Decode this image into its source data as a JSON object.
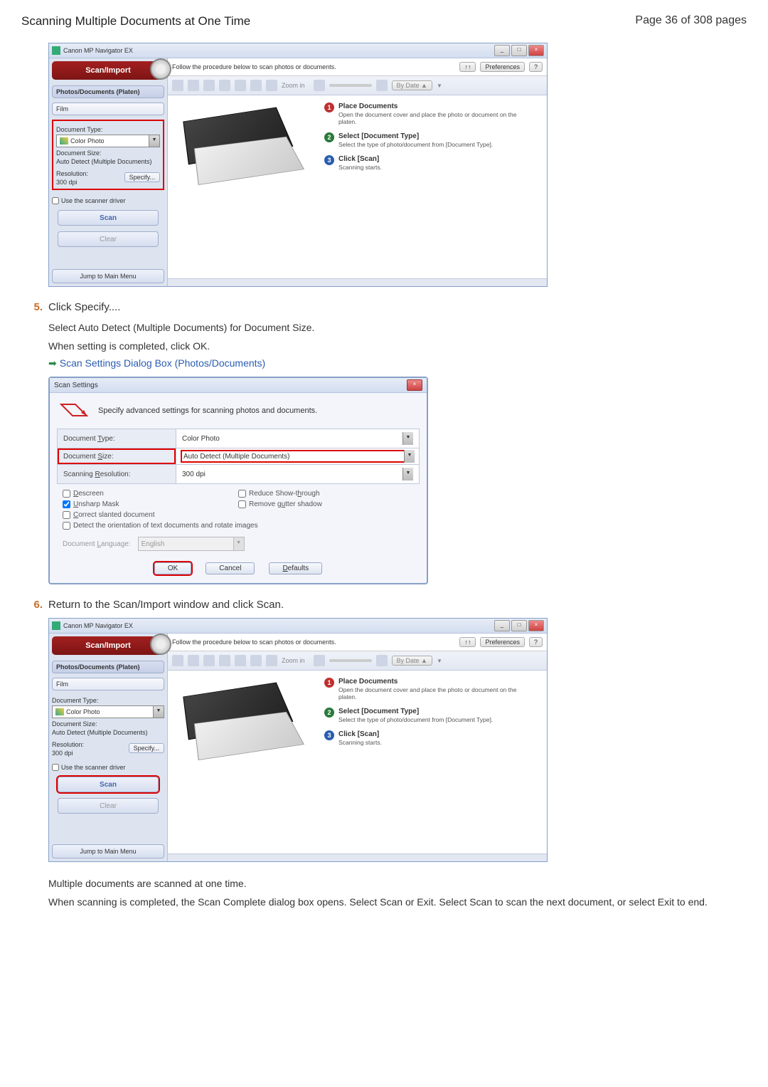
{
  "header": {
    "title": "Scanning Multiple Documents at One Time",
    "page_info": "Page 36 of 308 pages"
  },
  "app": {
    "window_title": "Canon MP Navigator EX",
    "top_instruction": "Follow the procedure below to scan photos or documents.",
    "sort_btn": "↑↑",
    "pref_btn": "Preferences",
    "help_btn": "?",
    "zoom_label": "Zoom in",
    "bydate": "By Date ▲",
    "scan_import": "Scan/Import",
    "tab_photos": "Photos/Documents (Platen)",
    "tab_film": "Film",
    "doc_type_label": "Document Type:",
    "doc_type_value": "Color Photo",
    "doc_size_label": "Document Size:",
    "doc_size_value": "Auto Detect (Multiple Documents)",
    "resolution_label": "Resolution:",
    "resolution_value": "300 dpi",
    "specify": "Specify...",
    "use_driver": "Use the scanner driver",
    "scan_btn": "Scan",
    "clear_btn": "Clear",
    "jump_btn": "Jump to Main Menu",
    "inst1_title": "Place Documents",
    "inst1_sub": "Open the document cover and place the photo or document on the platen.",
    "inst2_title": "Select [Document Type]",
    "inst2_sub": "Select the type of photo/document from [Document Type].",
    "inst3_title": "Click [Scan]",
    "inst3_sub": "Scanning starts."
  },
  "steps": {
    "s5_num": "5.",
    "s5_text": "Click Specify....",
    "s5_sub1": "Select Auto Detect (Multiple Documents) for Document Size.",
    "s5_sub2": "When setting is completed, click OK.",
    "s5_link": "Scan Settings Dialog Box (Photos/Documents)",
    "s6_num": "6.",
    "s6_text": "Return to the Scan/Import window and click Scan.",
    "s6_sub1": "Multiple documents are scanned at one time.",
    "s6_sub2": "When scanning is completed, the Scan Complete dialog box opens. Select Scan or Exit. Select Scan to scan the next document, or select Exit to end."
  },
  "settings": {
    "title": "Scan Settings",
    "header_text": "Specify advanced settings for scanning photos and documents.",
    "row1_label": "Document Type:",
    "row1_value": "Color Photo",
    "row2_label": "Document Size:",
    "row2_value": "Auto Detect (Multiple Documents)",
    "row3_label": "Scanning Resolution:",
    "row3_value": "300 dpi",
    "opt_descreen": "Descreen",
    "opt_reduce": "Reduce Show-through",
    "opt_unsharp": "Unsharp Mask",
    "opt_gutter": "Remove gutter shadow",
    "opt_slanted": "Correct slanted document",
    "opt_orient": "Detect the orientation of text documents and rotate images",
    "lang_label": "Document Language:",
    "lang_value": "English",
    "ok": "OK",
    "cancel": "Cancel",
    "defaults": "Defaults"
  }
}
